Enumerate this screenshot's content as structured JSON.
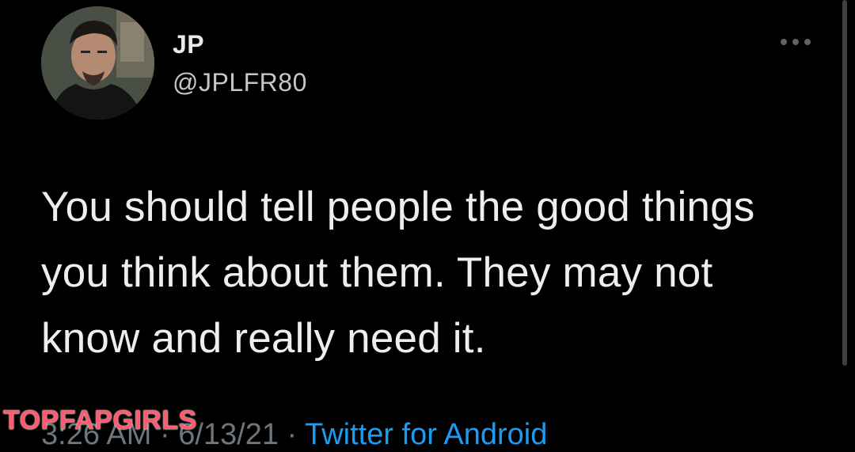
{
  "tweet": {
    "author": {
      "name": "JP",
      "handle": "@JPLFR80"
    },
    "text_lines": [
      "You should tell people the good things",
      "you think about them. They may not",
      "know and really need it."
    ],
    "meta": {
      "time": "3:26 AM",
      "separator": " · ",
      "date": "6/13/21",
      "source": "Twitter for Android"
    },
    "more_icon": "more-horizontal-icon"
  },
  "watermark": {
    "text": "TOPFAPGIRLS"
  },
  "colors": {
    "background": "#000000",
    "text": "#e7e9ea",
    "secondary_text": "#6e767d",
    "link": "#1d9bf0",
    "watermark": "#ff5a6e"
  }
}
